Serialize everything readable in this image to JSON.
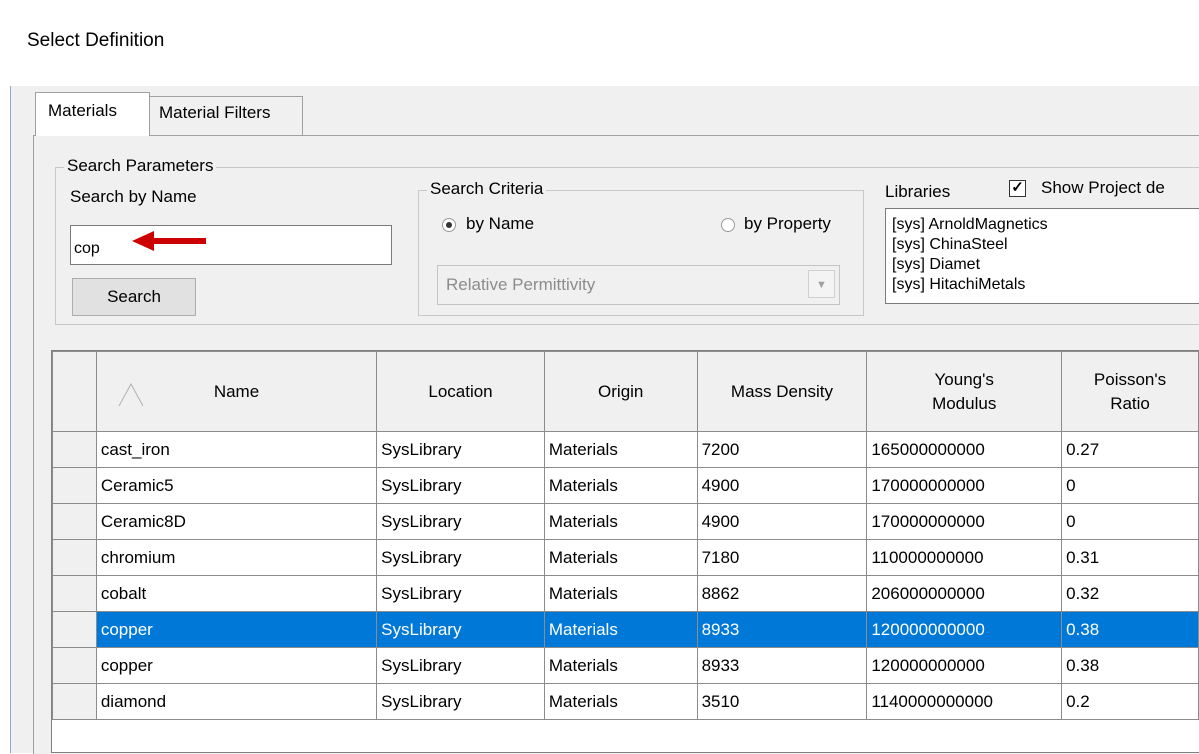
{
  "window": {
    "title": "Select Definition"
  },
  "tabs": [
    {
      "label": "Materials"
    },
    {
      "label": "Material Filters"
    }
  ],
  "search": {
    "group_label": "Search Parameters",
    "by_name_label": "Search by Name",
    "query": "cop",
    "button_label": "Search"
  },
  "criteria": {
    "group_label": "Search Criteria",
    "by_name_label": "by Name",
    "by_property_label": "by Property",
    "selected": "by Name",
    "property_value": "Relative Permittivity"
  },
  "libraries": {
    "label": "Libraries",
    "show_project_label": "Show Project de",
    "show_project_checked": true,
    "items": [
      "[sys] ArnoldMagnetics",
      "[sys] ChinaSteel",
      "[sys] Diamet",
      "[sys] HitachiMetals"
    ]
  },
  "table": {
    "columns": [
      "Name",
      "Location",
      "Origin",
      "Mass Density",
      "Young's Modulus",
      "Poisson's Ratio"
    ],
    "sort_column": "Name",
    "selected_row": 5,
    "rows": [
      [
        "cast_iron",
        "SysLibrary",
        "Materials",
        "7200",
        "165000000000",
        "0.27"
      ],
      [
        "Ceramic5",
        "SysLibrary",
        "Materials",
        "4900",
        "170000000000",
        "0"
      ],
      [
        "Ceramic8D",
        "SysLibrary",
        "Materials",
        "4900",
        "170000000000",
        "0"
      ],
      [
        "chromium",
        "SysLibrary",
        "Materials",
        "7180",
        "110000000000",
        "0.31"
      ],
      [
        "cobalt",
        "SysLibrary",
        "Materials",
        "8862",
        "206000000000",
        "0.32"
      ],
      [
        "copper",
        "SysLibrary",
        "Materials",
        "8933",
        "120000000000",
        "0.38"
      ],
      [
        "copper",
        "SysLibrary",
        "Materials",
        "8933",
        "120000000000",
        "0.38"
      ],
      [
        "diamond",
        "SysLibrary",
        "Materials",
        "3510",
        "1140000000000",
        "0.2"
      ]
    ]
  },
  "colors": {
    "selection": "#0078d7",
    "annotation_arrow": "#cc0000"
  }
}
